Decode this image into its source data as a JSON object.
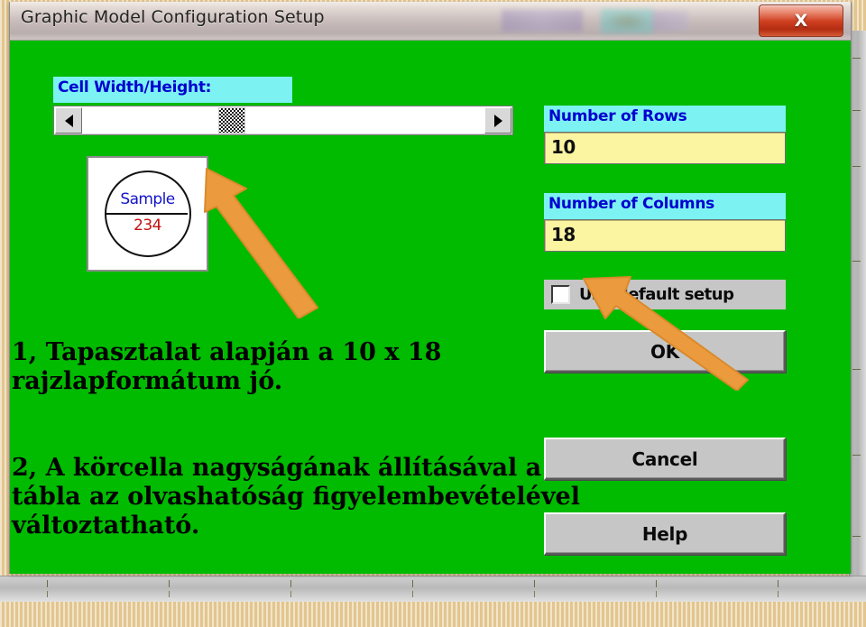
{
  "window": {
    "title": "Graphic Model Configuration Setup",
    "close_button_glyph": "X",
    "close_icon_name": "close-icon",
    "background_color": "#00bb00",
    "titlebar_color": "#c8bcbb"
  },
  "cell_size": {
    "label": "Cell Width/Height:",
    "scrollbar": {
      "left_arrow_name": "scroll-left-arrow",
      "right_arrow_name": "scroll-right-arrow",
      "thumb_name": "scroll-thumb",
      "thumb_position_percent": 37
    }
  },
  "sample_preview": {
    "top_text": "Sample",
    "bottom_text": "234",
    "top_text_color": "#1414c8",
    "bottom_text_color": "#c41010"
  },
  "fields": {
    "rows": {
      "label": "Number of Rows",
      "value": "10"
    },
    "columns": {
      "label": "Number of Columns",
      "value": "18"
    },
    "label_bg_color": "#7cf2f2",
    "label_text_color": "#0000d0",
    "input_bg_color": "#fbf5a2"
  },
  "options": {
    "use_default_setup_label": "Use default setup",
    "use_default_setup_checked": false
  },
  "buttons": {
    "ok": "OK",
    "cancel": "Cancel",
    "help": "Help"
  },
  "annotations": {
    "note_one": "1, Tapasztalat alapján a 10 x 18 rajzlapformátum  jó.",
    "note_two": "2, A körcella nagyságának állításával a tábla az olvashatóság figyelembevételével változtatható.",
    "arrow_color": "#eb9b3d",
    "arrow_one_target": "scroll-thumb",
    "arrow_two_target": "number-of-columns-input"
  }
}
